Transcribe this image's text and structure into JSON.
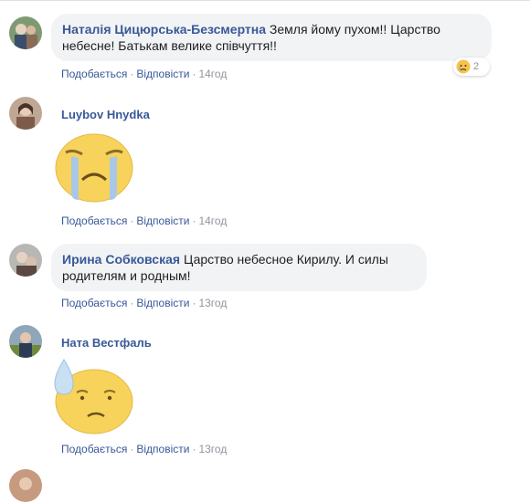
{
  "comments": [
    {
      "author": "Наталія Цицюрська-Безсмертна",
      "text": "Земля йому пухом!! Царство небесне! Батькам велике співчуття!!",
      "line1": "Земля йому пухом!! Царство",
      "line2": "небесне! Батькам велике співчуття!!",
      "like": "Подобається",
      "reply": "Відповісти",
      "time": "14год",
      "reaction_count": "2",
      "reaction_icon": "sad-face-icon"
    },
    {
      "author": "Luybov Hnydka",
      "sticker": "crying-face-sticker",
      "like": "Подобається",
      "reply": "Відповісти",
      "time": "14год"
    },
    {
      "author": "Ирина Собковская",
      "line1": "Царство небесное Кирилу. И силы",
      "line2": "родителям и родным!",
      "like": "Подобається",
      "reply": "Відповісти",
      "time": "13год"
    },
    {
      "author": "Ната Вестфаль",
      "sticker": "sweat-drop-face-sticker",
      "like": "Подобається",
      "reply": "Відповісти",
      "time": "13год"
    }
  ],
  "colors": {
    "link": "#385898",
    "bubble": "#f2f3f5",
    "meta": "#90949c",
    "sticker_yellow": "#f7d35b",
    "tear_blue": "#a9c8e8"
  }
}
